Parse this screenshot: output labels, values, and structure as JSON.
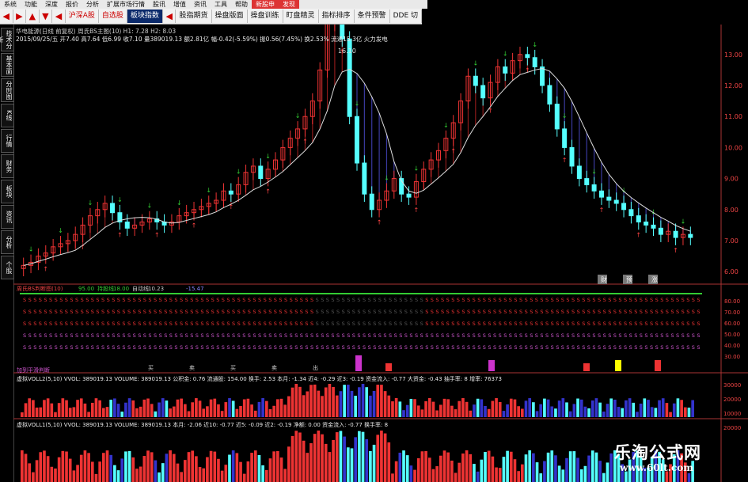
{
  "menu": [
    "系统",
    "功能",
    "深度",
    "报价",
    "分析",
    "扩展市场行情",
    "股讯",
    "增值",
    "资讯",
    "工具",
    "帮助",
    "新股申",
    "发现"
  ],
  "toolbar": {
    "tab_label": "沪深A股",
    "self_label": "自选股",
    "sector_label": "板块指数",
    "right_buttons": [
      "股指期货",
      "操盘版面",
      "操盘训练",
      "盯盘精灵",
      "指标排序",
      "条件预警",
      "DDE 切"
    ]
  },
  "leftbar": [
    "技术分析",
    "基本面",
    "分时图",
    "K线",
    "行情",
    "财务",
    "板块",
    "资讯",
    "分析",
    "个股"
  ],
  "logo_label": "首",
  "header": {
    "line1": "华电能源(日线 前复权) 周氏BS主图(10) H1: 7.28 H2: 8.03",
    "line2": "2015/09/25/五 开7.40 高7.64 低6.99 收7.10 量389019.13 额2.81亿 幅-0.42(-5.59%) 振0.56(7.45%) 换2.53% 流通15.3亿 火力发电"
  },
  "peak_label": "16.10",
  "price_axis": [
    "13.00",
    "12.00",
    "11.00",
    "10.00",
    "9.00",
    "8.00",
    "7.00",
    "6.00"
  ],
  "price_markers": [
    "财",
    "预",
    "涨"
  ],
  "bs_panel": {
    "label": "周氏BS判断图(10)",
    "v1": "95.00",
    "v1_label": "持股线:",
    "v1_value": "18.00",
    "v2_label": "自动线:",
    "v2_value": "10.23",
    "v3": "-15.47",
    "axis": [
      "80.00",
      "70.00",
      "60.00",
      "50.00",
      "40.00",
      "30.00"
    ],
    "event_labels": [
      "买",
      "卖",
      "买",
      "卖",
      "出"
    ],
    "bottom_label": "加到平滑判断"
  },
  "vol1": {
    "text": "虚拟VOLL2(5,10) VVOL: 389019.13   VOLUME: 389019.13  公积金: 0.76   流通股: 154.00  换手: 2.53  本月: -1.34  近4: -0.29  近3: -0.19  资金流入: -0.77  大资金: -0.43  抽手率: 8  增率: 76373",
    "axis": [
      "30000",
      "20000",
      "10000"
    ]
  },
  "vol2": {
    "text": "虚拟VOLL1(5,10) VVOL: 389019.13   VOLUME: 389019.13  本月: -2.06  近10: -0.77  近5: -0.09  近2: -0.19  净额: 0.00  资金流入: -0.77  换手率: 8",
    "axis": [
      "20000"
    ]
  },
  "watermark": {
    "text": "乐淘公式网",
    "url": "www.60lt.com"
  },
  "colors": {
    "up": "#e33",
    "down": "#5ff",
    "ma": "#ddd",
    "shade_down": "#3a3aa0",
    "shade_up": "#8b1a1a",
    "buy": "#3c3",
    "sell": "#f44"
  },
  "chart_data": {
    "type": "candlestick",
    "title": "华电能源(日线 前复权)",
    "ylim": [
      5.8,
      13.2
    ],
    "close": [
      6.2,
      6.3,
      6.5,
      6.6,
      6.8,
      6.9,
      7.0,
      7.2,
      7.5,
      7.8,
      8.0,
      8.2,
      7.9,
      7.6,
      7.4,
      7.5,
      7.6,
      7.7,
      7.6,
      7.5,
      7.6,
      7.8,
      7.9,
      8.0,
      8.1,
      8.2,
      8.3,
      8.6,
      8.5,
      8.8,
      9.2,
      9.4,
      9.0,
      9.3,
      9.6,
      10.0,
      10.3,
      10.6,
      11.0,
      11.5,
      12.5,
      14.0,
      16.1,
      13.5,
      11.0,
      9.5,
      8.5,
      8.0,
      8.3,
      8.6,
      9.0,
      8.5,
      8.4,
      8.9,
      9.3,
      9.6,
      9.9,
      10.3,
      10.8,
      11.5,
      12.3,
      12.0,
      11.6,
      12.1,
      12.6,
      12.4,
      12.8,
      13.0,
      12.9,
      12.6,
      12.0,
      11.4,
      10.6,
      10.0,
      9.4,
      9.0,
      8.8,
      8.6,
      8.4,
      8.3,
      8.2,
      8.0,
      7.8,
      7.6,
      7.5,
      7.4,
      7.2,
      7.3,
      7.1,
      7.2,
      7.1
    ]
  }
}
